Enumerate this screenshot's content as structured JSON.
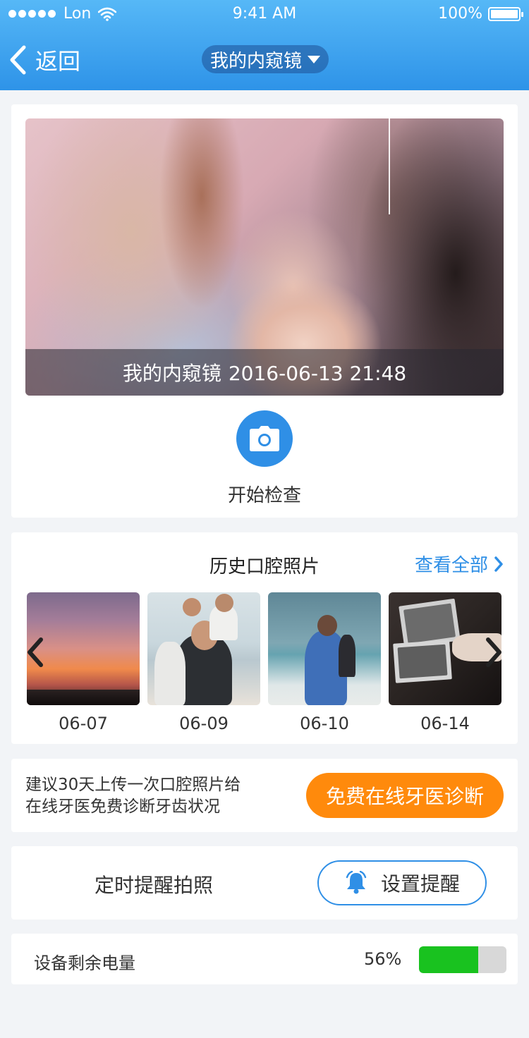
{
  "status_bar": {
    "carrier": "Lon",
    "time": "9:41 AM",
    "battery_percent": "100%"
  },
  "nav": {
    "back_label": "返回",
    "title": "我的内窥镜"
  },
  "preview": {
    "caption_device": "我的内窥镜",
    "caption_datetime": "2016-06-13 21:48",
    "camera_label": "开始检查"
  },
  "history": {
    "title": "历史口腔照片",
    "view_all_label": "查看全部",
    "photos": [
      {
        "date": "06-07"
      },
      {
        "date": "06-09"
      },
      {
        "date": "06-10"
      },
      {
        "date": "06-14"
      }
    ]
  },
  "diagnosis": {
    "text_line1": "建议30天上传一次口腔照片给",
    "text_line2": "在线牙医免费诊断牙齿状况",
    "button_label": "免费在线牙医诊断"
  },
  "reminder": {
    "label": "定时提醒拍照",
    "button_label": "设置提醒"
  },
  "battery": {
    "label": "设备剩余电量",
    "value_text": "56%",
    "level_fraction": 0.68
  },
  "colors": {
    "accent_blue": "#2f8fe6",
    "accent_orange": "#ff8a0c",
    "battery_green": "#19c21f"
  },
  "icons": {
    "wifi": "wifi-icon",
    "back": "chevron-left-icon",
    "dropdown": "caret-down-icon",
    "camera": "camera-icon",
    "view_all": "chevron-right-icon",
    "carousel_prev": "chevron-left-icon",
    "carousel_next": "chevron-right-icon",
    "bell": "bell-icon"
  }
}
